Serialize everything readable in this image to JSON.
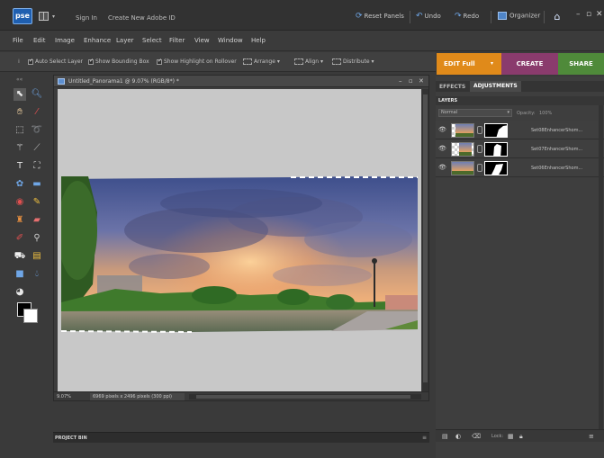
{
  "topbar": {
    "logo": "pse",
    "sign_in": "Sign In",
    "create_id": "Create New Adobe ID",
    "reset_panels": "Reset Panels",
    "undo": "Undo",
    "redo": "Redo",
    "organizer": "Organizer"
  },
  "menu": [
    "File",
    "Edit",
    "Image",
    "Enhance",
    "Layer",
    "Select",
    "Filter",
    "View",
    "Window",
    "Help"
  ],
  "options": {
    "auto_select": "Auto Select Layer",
    "bounding_box": "Show Bounding Box",
    "highlight": "Show Highlight on Rollover",
    "arrange": "Arrange",
    "align": "Align",
    "distribute": "Distribute"
  },
  "modes": {
    "edit": "EDIT Full",
    "create": "CREATE",
    "share": "SHARE"
  },
  "document": {
    "title": "Untitled_Panorama1 @ 9.07% (RGB/8*) *",
    "zoom": "9.07%",
    "size": "6969 pixels x 2496 pixels (300 ppi)"
  },
  "project_bin": {
    "label": "PROJECT BIN"
  },
  "panel": {
    "tab_effects": "EFFECTS",
    "tab_adjustments": "ADJUSTMENTS",
    "layers_label": "LAYERS",
    "blend_mode": "Normal",
    "opacity_label": "Opacity:",
    "opacity_value": "100%",
    "lock_label": "Lock:",
    "layers": [
      {
        "name": "Set08EnhancerShom..."
      },
      {
        "name": "Set07EnhancerShom..."
      },
      {
        "name": "Set06EnhancerShom..."
      }
    ]
  },
  "colors": {
    "edit_tab": "#e08a1a",
    "create_tab": "#8a3b6d",
    "share_tab": "#4f8a3a",
    "canvas_bg": "#c8c8c8"
  }
}
